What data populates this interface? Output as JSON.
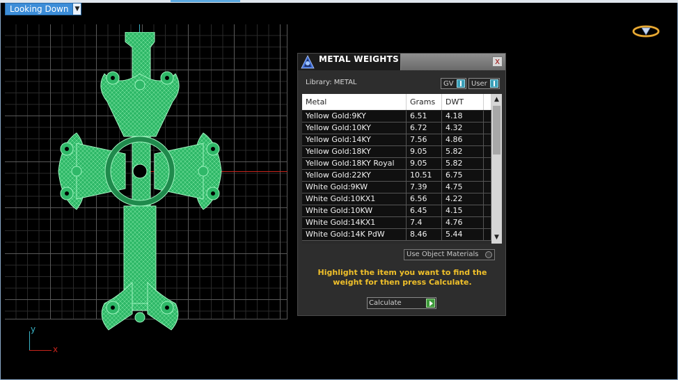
{
  "viewport": {
    "view_label": "Looking Down",
    "axis_y_label": "y",
    "axis_x_label": "x",
    "colors": {
      "model": "#3fd47a",
      "axis_x": "#c8241c",
      "axis_y": "#3ab5c8",
      "grid": "#5a5a5a"
    }
  },
  "top_right_icon": "ring-icon",
  "metal_weights_panel": {
    "title": "METAL WEIGHTS",
    "close_label": "x",
    "library_label": "Library: METAL",
    "toggle_gv": "GV",
    "toggle_user": "User",
    "columns": [
      "Metal",
      "Grams",
      "DWT"
    ],
    "rows": [
      [
        "Yellow Gold:9KY",
        "6.51",
        "4.18"
      ],
      [
        "Yellow Gold:10KY",
        "6.72",
        "4.32"
      ],
      [
        "Yellow Gold:14KY",
        "7.56",
        "4.86"
      ],
      [
        "Yellow Gold:18KY",
        "9.05",
        "5.82"
      ],
      [
        "Yellow Gold:18KY Royal",
        "9.05",
        "5.82"
      ],
      [
        "Yellow Gold:22KY",
        "10.51",
        "6.75"
      ],
      [
        "White Gold:9KW",
        "7.39",
        "4.75"
      ],
      [
        "White Gold:10KX1",
        "6.56",
        "4.22"
      ],
      [
        "White Gold:10KW",
        "6.45",
        "4.15"
      ],
      [
        "White Gold:14KX1",
        "7.4",
        "4.76"
      ],
      [
        "White Gold:14K PdW",
        "8.46",
        "5.44"
      ]
    ],
    "use_object_materials": "Use Object Materials",
    "instruction": "Highlight the item you want to find the weight for then press Calculate.",
    "calculate_label": "Calculate",
    "accent_color": "#f0c02a"
  }
}
